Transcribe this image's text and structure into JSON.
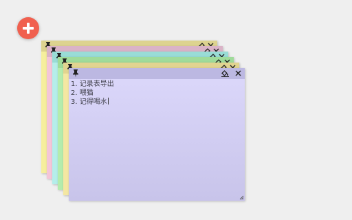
{
  "toolbar": {
    "add_icon": "plus-icon",
    "accent": "#f0604f"
  },
  "stack_notes": [
    {
      "color": "#f6ef9d",
      "title_color": "#ddd38f"
    },
    {
      "color": "#f4c6d8",
      "title_color": "#dab3c7"
    },
    {
      "color": "#b5eeea",
      "title_color": "#99dcd6"
    },
    {
      "color": "#b4ecad",
      "title_color": "#9fdb9a"
    },
    {
      "color": "#f4e7a2",
      "title_color": "#e1d490"
    }
  ],
  "active_note": {
    "color": "#d8d4f7",
    "title_color": "#bcb8e2",
    "icons": {
      "pin": "pin-icon",
      "color": "paint-bucket-icon",
      "close": "close-icon"
    },
    "lines": [
      "1. 记录表导出",
      "2. 喂猫",
      "3. 记得喝水"
    ]
  }
}
